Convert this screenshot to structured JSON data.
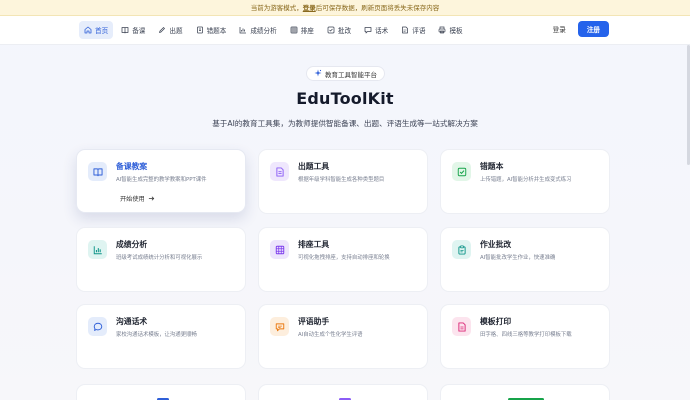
{
  "banner": {
    "prefix": "当前为游客模式，",
    "login_link": "登录",
    "suffix": "后可保存数据，刷新页面将丢失未保存内容"
  },
  "nav": {
    "items": [
      {
        "label": "首页",
        "icon": "home-icon"
      },
      {
        "label": "备课",
        "icon": "book-icon"
      },
      {
        "label": "出题",
        "icon": "pen-icon"
      },
      {
        "label": "错题本",
        "icon": "notebook-icon"
      },
      {
        "label": "成绩分析",
        "icon": "chart-icon"
      },
      {
        "label": "排座",
        "icon": "grid-icon"
      },
      {
        "label": "批改",
        "icon": "check-icon"
      },
      {
        "label": "话术",
        "icon": "chat-icon"
      },
      {
        "label": "评语",
        "icon": "doc-icon"
      },
      {
        "label": "模板",
        "icon": "printer-icon"
      }
    ],
    "active_index": 0,
    "login_label": "登录",
    "register_label": "注册"
  },
  "hero": {
    "badge": "教育工具智能平台",
    "title": "EduToolKit",
    "subtitle": "基于AI的教育工具集，为教师提供智能备课、出题、评语生成等一站式解决方案"
  },
  "cards": [
    {
      "title": "备课教案",
      "desc": "AI智能生成完整的教学教案和PPT课件",
      "icon": "book-open-icon",
      "icon_color": "#2f5fd8",
      "icon_bg": "#e4ecfb",
      "start_label": "开始使用"
    },
    {
      "title": "出题工具",
      "desc": "根据年级学科智能生成各种类型题目",
      "icon": "file-text-icon",
      "icon_color": "#8b5cf6",
      "icon_bg": "#efe7fd"
    },
    {
      "title": "错题本",
      "desc": "上传错题，AI智能分析并生成变式练习",
      "icon": "check-square-icon",
      "icon_color": "#16a34a",
      "icon_bg": "#e2f6e8"
    },
    {
      "title": "成绩分析",
      "desc": "班级考试成绩统计分析和可视化展示",
      "icon": "bar-chart-icon",
      "icon_color": "#0d9488",
      "icon_bg": "#dff4f1"
    },
    {
      "title": "排座工具",
      "desc": "可视化拖拽排座，支持自动排座和轮换",
      "icon": "grid-icon",
      "icon_color": "#7c3aed",
      "icon_bg": "#ede5fc"
    },
    {
      "title": "作业批改",
      "desc": "AI智能批改学生作业，快速准确",
      "icon": "clipboard-icon",
      "icon_color": "#0d9488",
      "icon_bg": "#dff4f1"
    },
    {
      "title": "沟通话术",
      "desc": "家校沟通话术模板，让沟通更顺畅",
      "icon": "message-icon",
      "icon_color": "#2f5fd8",
      "icon_bg": "#e4ecfb"
    },
    {
      "title": "评语助手",
      "desc": "AI自动生成个性化学生评语",
      "icon": "comment-icon",
      "icon_color": "#ea7a12",
      "icon_bg": "#fdeedd"
    },
    {
      "title": "模板打印",
      "desc": "田字格、四线三格等教学打印模板下载",
      "icon": "file-print-icon",
      "icon_color": "#db2777",
      "icon_bg": "#fce4ee"
    }
  ],
  "stats": [
    {
      "color": "#2f5fd8"
    },
    {
      "color": "#8b5cf6"
    },
    {
      "color": "#16a34a"
    }
  ],
  "colors": {
    "accent": "#2563eb",
    "banner_bg": "#fdf5dc"
  }
}
